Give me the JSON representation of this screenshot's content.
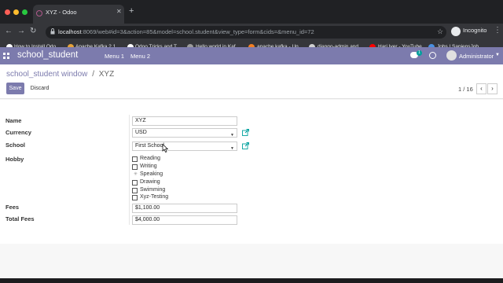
{
  "browser": {
    "tab_title": "XYZ - Odoo",
    "url_host": "localhost",
    "url_rest": ":8069/web#id=3&action=85&model=school.student&view_type=form&cids=&menu_id=72",
    "incognito_label": "Incognito",
    "bookmarks": [
      {
        "label": "How to Install Odo...",
        "icon_color": "#ffffff"
      },
      {
        "label": "Apache Kafka 2.1...",
        "icon_color": "#e5a23a"
      },
      {
        "label": "Odoo Tricks and T...",
        "icon_color": "#ffffff"
      },
      {
        "label": "Hello world in Kaf...",
        "icon_color": "#9b9b9b"
      },
      {
        "label": "apache kafka - Un...",
        "icon_color": "#f48024"
      },
      {
        "label": "django-admin and...",
        "icon_color": "#d0d0d0"
      },
      {
        "label": "Hari Iyer - YouTube",
        "icon_color": "#ff0000"
      },
      {
        "label": "Jobs | SapiensJob...",
        "icon_color": "#4a90e2"
      }
    ]
  },
  "odoo": {
    "brand": "school_student",
    "menus": [
      "Menu 1",
      "Menu 2"
    ],
    "chat_count": "1",
    "user": "Administrator",
    "accent": "#7c7bad"
  },
  "control": {
    "breadcrumb_parent": "school_student window",
    "breadcrumb_sep": "/",
    "breadcrumb_current": "XYZ",
    "save_label": "Save",
    "discard_label": "Discard",
    "pager": "1 / 16"
  },
  "form": {
    "labels": {
      "name": "Name",
      "currency": "Currency",
      "school": "School",
      "hobby": "Hobby",
      "fees": "Fees",
      "total_fees": "Total Fees"
    },
    "name_value": "XYZ",
    "currency_value": "USD",
    "school_value": "First School",
    "hobbies": [
      {
        "label": "Reading",
        "checked": false
      },
      {
        "label": "Writing",
        "checked": false
      },
      {
        "label": "Speaking",
        "checked": false
      },
      {
        "label": "Drawing",
        "checked": false
      },
      {
        "label": "Swimming",
        "checked": false
      },
      {
        "label": "Xyz-Testing",
        "checked": false
      }
    ],
    "fees_value": "$1,100.00",
    "total_fees_value": "$4,000.00"
  }
}
